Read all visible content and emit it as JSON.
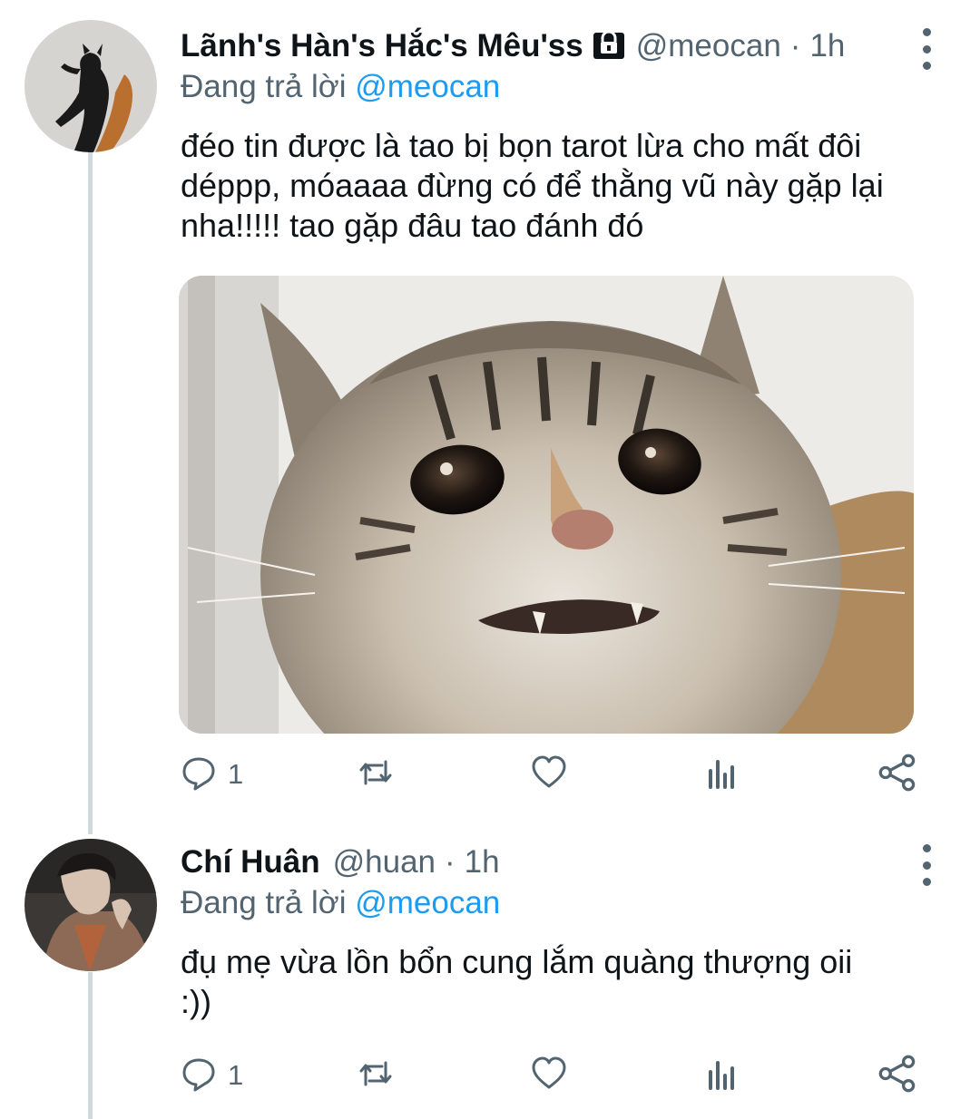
{
  "tweets": [
    {
      "name": "Lãnh's Hàn's Hắc's Mêu'ss",
      "handle": "@meocan",
      "separator": "·",
      "time": "1h",
      "replying_prefix": "Đang trả lời",
      "replying_to": "@meocan",
      "text": "đéo tin được là tao bị bọn tarot lừa cho mất đôi déppp, móaaaa đừng có để thằng vũ này gặp lại nha!!!!! tao gặp đâu tao đánh đó",
      "has_media": true,
      "protected": true,
      "reply_count": "1"
    },
    {
      "name": "Chí Huân",
      "handle": "@huan",
      "separator": "·",
      "time": "1h",
      "replying_prefix": "Đang trả lời",
      "replying_to": "@meocan",
      "text": "đụ mẹ vừa lồn bổn cung lắm quàng thượng oii :))",
      "has_media": false,
      "protected": false,
      "reply_count": "1"
    }
  ],
  "icons": [
    "lock-icon",
    "more-vertical-icon",
    "reply-icon",
    "retweet-icon",
    "like-icon",
    "analytics-icon",
    "share-icon"
  ],
  "colors": {
    "link": "#1d9bf0",
    "secondary": "#536471",
    "thread_line": "#cfd9de",
    "text": "#0f1419"
  }
}
